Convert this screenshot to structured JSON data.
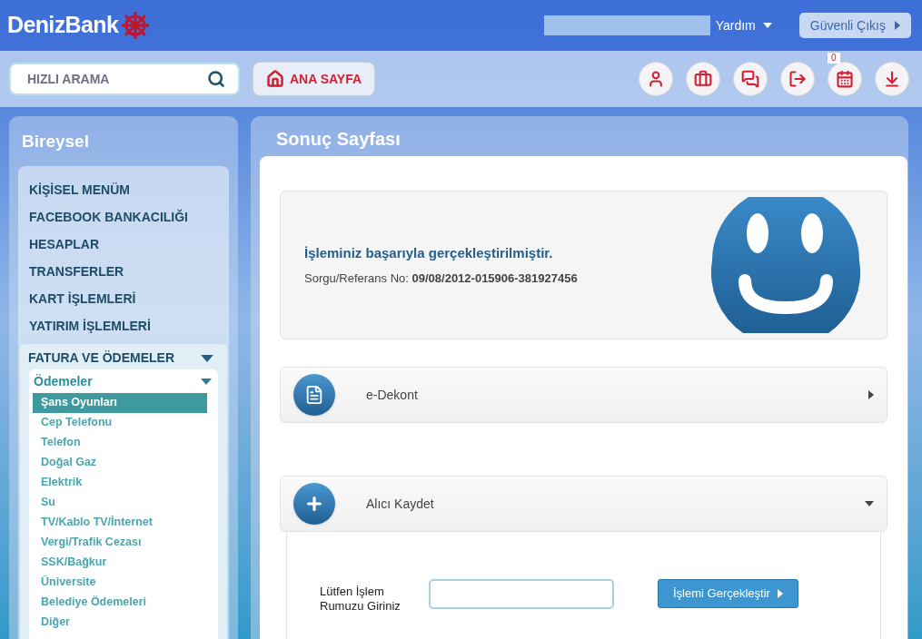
{
  "header": {
    "logo": "DenizBank",
    "help": "Yardım",
    "logout": "Güvenli Çıkış"
  },
  "toolbar": {
    "search": {
      "placeholder": "HIZLI ARAMA"
    },
    "home": "ANA SAYFA",
    "icons": [
      {
        "kind": "person"
      },
      {
        "kind": "briefcase"
      },
      {
        "kind": "chat"
      },
      {
        "kind": "exit"
      },
      {
        "kind": "calendar",
        "badge": "0"
      },
      {
        "kind": "download"
      }
    ]
  },
  "sidebar": {
    "title": "Bireysel",
    "items": [
      {
        "label": "KİŞİSEL MENÜM"
      },
      {
        "label": "FACEBOOK BANKACILIĞI"
      },
      {
        "label": "HESAPLAR"
      },
      {
        "label": "TRANSFERLER"
      },
      {
        "label": "KART İŞLEMLERİ"
      },
      {
        "label": "YATIRIM İŞLEMLERİ"
      }
    ],
    "section": {
      "label": "FATURA VE ÖDEMELER",
      "expanded": true,
      "group": {
        "label": "Ödemeler",
        "expanded": true,
        "children": [
          {
            "label": "Şans Oyunları",
            "selected": true
          },
          {
            "label": "Cep Telefonu",
            "selected": false
          },
          {
            "label": "Telefon",
            "selected": false
          },
          {
            "label": "Doğal Gaz",
            "selected": false
          },
          {
            "label": "Elektrik",
            "selected": false
          },
          {
            "label": "Su",
            "selected": false
          },
          {
            "label": "TV/Kablo TV/İnternet",
            "selected": false
          },
          {
            "label": "Vergi/Trafik Cezası",
            "selected": false
          },
          {
            "label": "SSK/Bağkur",
            "selected": false
          },
          {
            "label": "Üniversite",
            "selected": false
          },
          {
            "label": "Belediye Ödemeleri",
            "selected": false
          },
          {
            "label": "Diğer",
            "selected": false
          }
        ]
      }
    }
  },
  "main": {
    "title": "Sonuç Sayfası",
    "result": {
      "message": "İşleminiz başarıyla gerçekleştirilmiştir.",
      "reference": "Sorgu/Referans No: **09/08/2012-015906-381927456**"
    },
    "panels": [
      {
        "kind": "document",
        "label": "e-Dekont",
        "expanded": false
      },
      {
        "kind": "add",
        "label": "Alıcı Kaydet",
        "expanded": true,
        "form": {
          "label": "Lütfen İşlem Rumuzu Giriniz",
          "button": "İşlemi Gerçekleştir"
        }
      }
    ]
  }
}
